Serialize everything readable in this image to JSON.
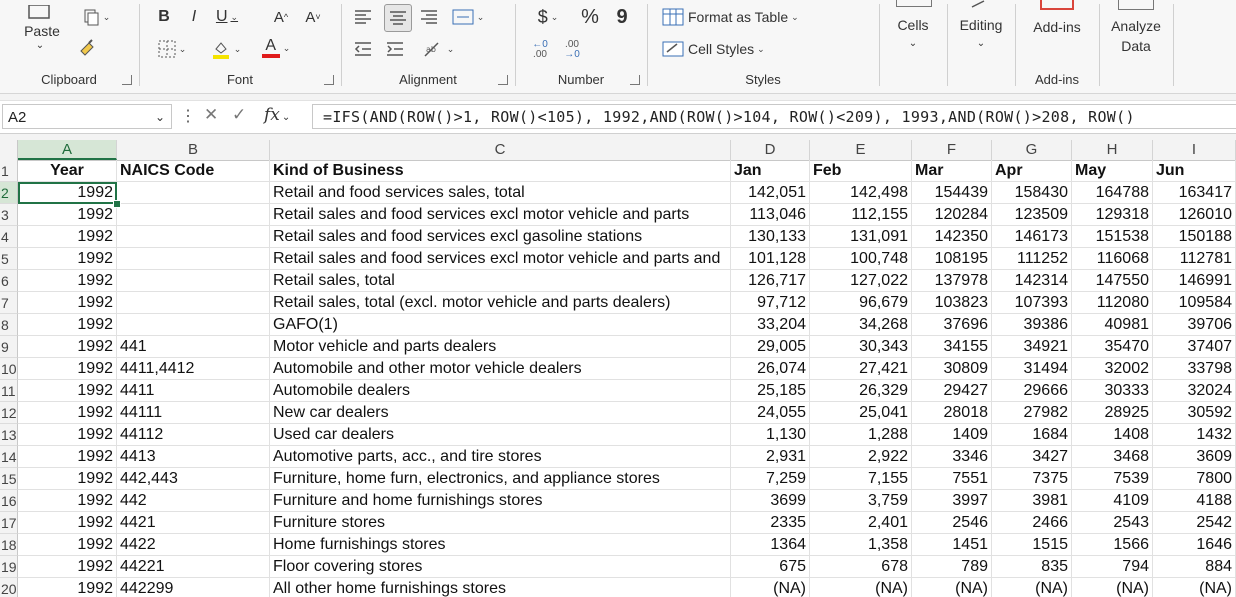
{
  "ribbon": {
    "clipboard": {
      "paste": "Paste",
      "label": "Clipboard"
    },
    "font": {
      "bold": "B",
      "italic": "I",
      "underline": "U",
      "grow": "A^",
      "shrink": "A˅",
      "color_a": "A",
      "label": "Font"
    },
    "alignment": {
      "label": "Alignment"
    },
    "number": {
      "currency": "$",
      "percent": "%",
      "comma": "9",
      "inc_dec": "←0 .00",
      "dec_dec": ".00 →0",
      "label": "Number"
    },
    "styles": {
      "format_table": "Format as Table",
      "cell_styles": "Cell Styles",
      "label": "Styles"
    },
    "cells": {
      "label": "Cells"
    },
    "editing": {
      "label": "Editing"
    },
    "addins": {
      "button": "Add-ins",
      "label": "Add-ins"
    },
    "analyze": {
      "line1": "Analyze",
      "line2": "Data"
    }
  },
  "formula_bar": {
    "name_box": "A2",
    "fx": "fx",
    "formula": "=IFS(AND(ROW()>1, ROW()<105), 1992,AND(ROW()>104, ROW()<209), 1993,AND(ROW()>208, ROW()"
  },
  "columns": [
    "A",
    "B",
    "C",
    "D",
    "E",
    "F",
    "G",
    "H",
    "I"
  ],
  "rows": [
    {
      "n": "1",
      "cells": [
        "Year",
        "NAICS  Code",
        "Kind of Business",
        "Jan",
        "Feb",
        "Mar",
        "Apr",
        "May",
        "Jun"
      ]
    },
    {
      "n": "2",
      "cells": [
        "1992",
        "",
        "Retail and food services sales, total",
        "142,051",
        "142,498",
        "154439",
        "158430",
        "164788",
        "163417"
      ]
    },
    {
      "n": "3",
      "cells": [
        "1992",
        "",
        "Retail sales and food services excl motor vehicle and parts",
        "113,046",
        "112,155",
        "120284",
        "123509",
        "129318",
        "126010"
      ]
    },
    {
      "n": "4",
      "cells": [
        "1992",
        "",
        "Retail sales and food services excl gasoline stations",
        "130,133",
        "131,091",
        "142350",
        "146173",
        "151538",
        "150188"
      ]
    },
    {
      "n": "5",
      "cells": [
        "1992",
        "",
        "Retail sales and food services excl motor vehicle and parts and",
        "101,128",
        "100,748",
        "108195",
        "111252",
        "116068",
        "112781"
      ]
    },
    {
      "n": "6",
      "cells": [
        "1992",
        "",
        "Retail sales, total",
        "126,717",
        "127,022",
        "137978",
        "142314",
        "147550",
        "146991"
      ]
    },
    {
      "n": "7",
      "cells": [
        "1992",
        "",
        "Retail sales, total (excl. motor vehicle and parts dealers)",
        "97,712",
        "96,679",
        "103823",
        "107393",
        "112080",
        "109584"
      ]
    },
    {
      "n": "8",
      "cells": [
        "1992",
        "",
        "GAFO(1)",
        "33,204",
        "34,268",
        "37696",
        "39386",
        "40981",
        "39706"
      ]
    },
    {
      "n": "9",
      "cells": [
        "1992",
        "441",
        "Motor vehicle and parts dealers",
        "29,005",
        "30,343",
        "34155",
        "34921",
        "35470",
        "37407"
      ]
    },
    {
      "n": "10",
      "cells": [
        "1992",
        "4411,4412",
        "Automobile and other motor vehicle dealers",
        "26,074",
        "27,421",
        "30809",
        "31494",
        "32002",
        "33798"
      ]
    },
    {
      "n": "11",
      "cells": [
        "1992",
        "4411",
        "Automobile dealers",
        "25,185",
        "26,329",
        "29427",
        "29666",
        "30333",
        "32024"
      ]
    },
    {
      "n": "12",
      "cells": [
        "1992",
        "44111",
        "New car dealers",
        "24,055",
        "25,041",
        "28018",
        "27982",
        "28925",
        "30592"
      ]
    },
    {
      "n": "13",
      "cells": [
        "1992",
        "44112",
        "Used car dealers",
        "1,130",
        "1,288",
        "1409",
        "1684",
        "1408",
        "1432"
      ]
    },
    {
      "n": "14",
      "cells": [
        "1992",
        "4413",
        "Automotive parts, acc., and tire stores",
        "2,931",
        "2,922",
        "3346",
        "3427",
        "3468",
        "3609"
      ]
    },
    {
      "n": "15",
      "cells": [
        "1992",
        "442,443",
        "Furniture, home furn, electronics, and appliance stores",
        "7,259",
        "7,155",
        "7551",
        "7375",
        "7539",
        "7800"
      ]
    },
    {
      "n": "16",
      "cells": [
        "1992",
        "442",
        "Furniture and home furnishings stores",
        "3699",
        "3,759",
        "3997",
        "3981",
        "4109",
        "4188"
      ]
    },
    {
      "n": "17",
      "cells": [
        "1992",
        "4421",
        "Furniture stores",
        "2335",
        "2,401",
        "2546",
        "2466",
        "2543",
        "2542"
      ]
    },
    {
      "n": "18",
      "cells": [
        "1992",
        "4422",
        "Home furnishings stores",
        "1364",
        "1,358",
        "1451",
        "1515",
        "1566",
        "1646"
      ]
    },
    {
      "n": "19",
      "cells": [
        "1992",
        "44221",
        "Floor covering stores",
        "675",
        "678",
        "789",
        "835",
        "794",
        "884"
      ]
    },
    {
      "n": "20",
      "cells": [
        "1992",
        "442299",
        "All other home furnishings stores",
        "(NA)",
        "(NA)",
        "(NA)",
        "(NA)",
        "(NA)",
        "(NA)"
      ]
    }
  ]
}
